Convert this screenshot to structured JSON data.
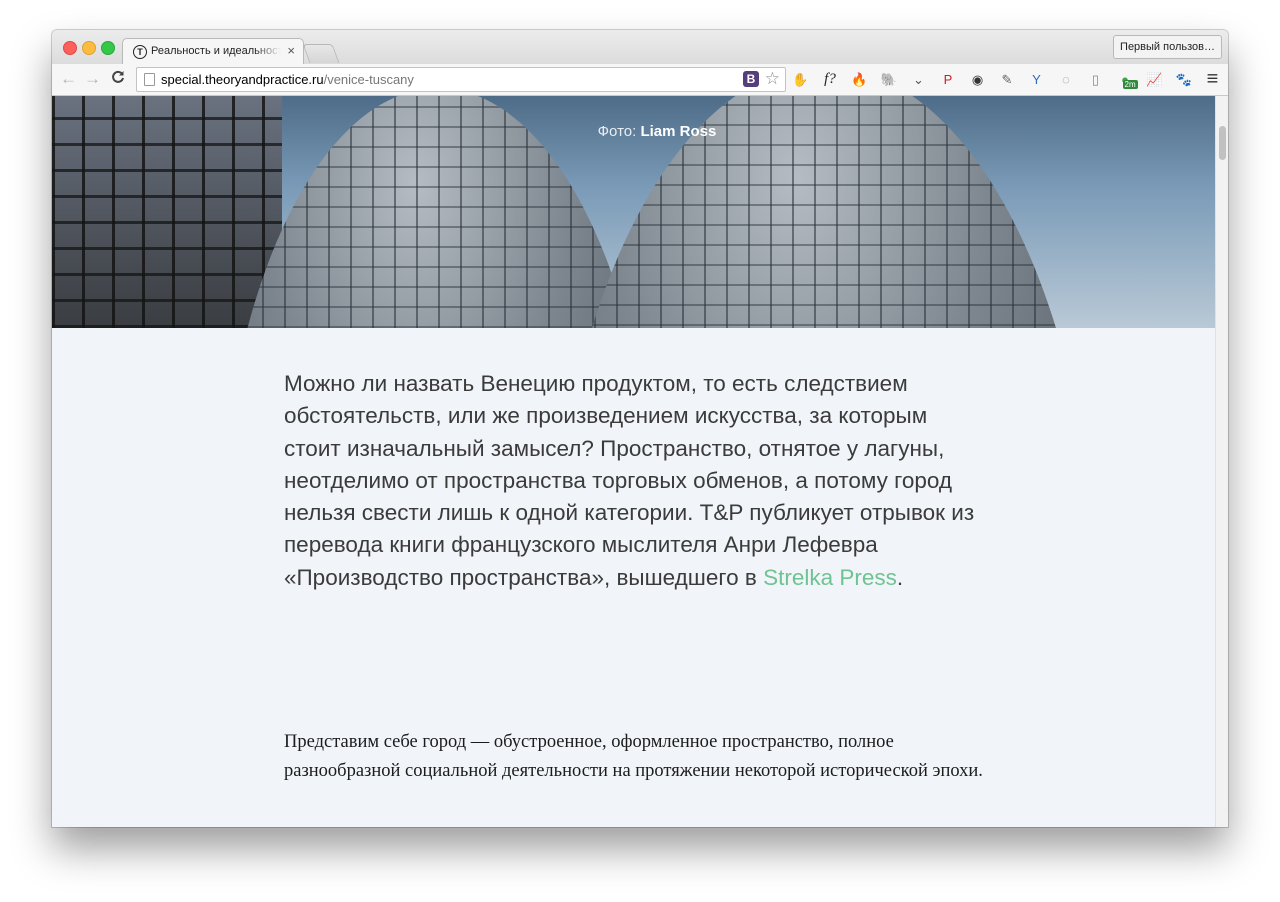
{
  "browser": {
    "tab_title": "Реальность и идеальност",
    "tab_close": "×",
    "tab_favicon": "T",
    "profile_button": "Первый пользов…",
    "nav": {
      "back": "←",
      "forward": "→",
      "reload": "C"
    },
    "url_host": "special.theoryandpractice.ru",
    "url_path": "/venice-tuscany",
    "bootstrap_icon": "B",
    "star": "☆",
    "extensions": [
      {
        "name": "adblock-icon",
        "glyph": "✋",
        "color": "#d9382f"
      },
      {
        "name": "f-question-icon",
        "glyph": "f?",
        "color": "#222222"
      },
      {
        "name": "fire-icon",
        "glyph": "🔥",
        "color": "#e8641a"
      },
      {
        "name": "evernote-icon",
        "glyph": "🐘",
        "color": "#555555"
      },
      {
        "name": "pocket-icon",
        "glyph": "⌄",
        "color": "#555555"
      },
      {
        "name": "pinterest-icon",
        "glyph": "P",
        "color": "#cb2027"
      },
      {
        "name": "lens-icon",
        "glyph": "◉",
        "color": "#333333"
      },
      {
        "name": "eyedropper-icon",
        "glyph": "✎",
        "color": "#666666"
      },
      {
        "name": "y-icon",
        "glyph": "Y",
        "color": "#2b6cc4"
      },
      {
        "name": "ring-icon",
        "glyph": "◌",
        "color": "#888888"
      },
      {
        "name": "reader-icon",
        "glyph": "▯",
        "color": "#888888"
      },
      {
        "name": "rss-badge-icon",
        "glyph": "●",
        "color": "#3ea34a",
        "badge": "2m"
      },
      {
        "name": "chart-icon",
        "glyph": "📈",
        "color": "#f08a24"
      },
      {
        "name": "paw-icon",
        "glyph": "🐾",
        "color": "#aaaaaa"
      },
      {
        "name": "menu-icon",
        "glyph": "≡",
        "color": "#333333"
      }
    ]
  },
  "hero": {
    "credit_prefix": "Фото:",
    "credit_author": "Liam Ross"
  },
  "article": {
    "lead_text": "Можно ли назвать Венецию продуктом, то есть следствием обстоятельств, или же произведением искусства, за которым стоит изначальный замысел? Пространство, отнятое у лагуны, неотделимо от пространства торговых обменов, а потому город нельзя свести лишь к одной категории. T&P публикует отрывок из перевода книги французского мыслителя Анри Лефевра «Производство пространства», вышедшего в",
    "lead_link": "Strelka Press",
    "lead_end": ".",
    "body_text": "Представим себе город — обустроенное, оформленное пространство, полное разнообразной социальной деятельности на протяжении некоторой исторической эпохи."
  },
  "colors": {
    "link": "#6fc393",
    "page_bg": "#f1f4f8"
  }
}
